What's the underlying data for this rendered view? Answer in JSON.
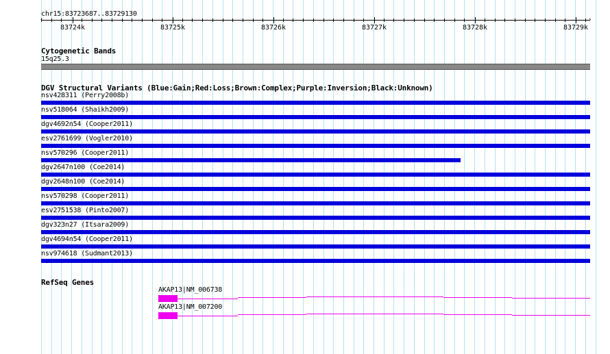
{
  "ruler": {
    "location": "chr15:83723687..83729130",
    "ticks": [
      "83724k",
      "83725k",
      "83726k",
      "83727k",
      "83728k",
      "83729k"
    ]
  },
  "cytoband": {
    "title": "Cytogenetic Bands",
    "band": "15q25.3",
    "color": "#888888"
  },
  "dgv": {
    "title": "DGV Structural Variants (Blue:Gain;Red:Loss;Brown:Complex;Purple:Inversion;Black:Unknown)",
    "gain_color": "#0000dd",
    "variants": [
      {
        "label": "nsv428311 (Perry2008b)",
        "type": "gain"
      },
      {
        "label": "nsv518064 (Shaikh2009)",
        "type": "gain"
      },
      {
        "label": "dgv4692n54 (Cooper2011)",
        "type": "gain"
      },
      {
        "label": "esv2761699 (Vogler2010)",
        "type": "gain"
      },
      {
        "label": "nsv570296 (Cooper2011)",
        "type": "gain"
      },
      {
        "label": "dgv2647n100 (Coe2014)",
        "type": "gain"
      },
      {
        "label": "dgv2648n100 (Coe2014)",
        "type": "gain"
      },
      {
        "label": "nsv570298 (Cooper2011)",
        "type": "gain"
      },
      {
        "label": "esv2751538 (Pinto2007)",
        "type": "gain"
      },
      {
        "label": "dgv323n27 (Itsara2009)",
        "type": "gain"
      },
      {
        "label": "dgv4694n54 (Cooper2011)",
        "type": "gain"
      },
      {
        "label": "nsv974618 (Sudmant2013)",
        "type": "gain"
      }
    ]
  },
  "refseq": {
    "title": "RefSeq Genes",
    "color": "#ee00ee",
    "transcripts": [
      {
        "label": "AKAP13|NM_006738"
      },
      {
        "label": "AKAP13|NM_007200"
      }
    ]
  }
}
